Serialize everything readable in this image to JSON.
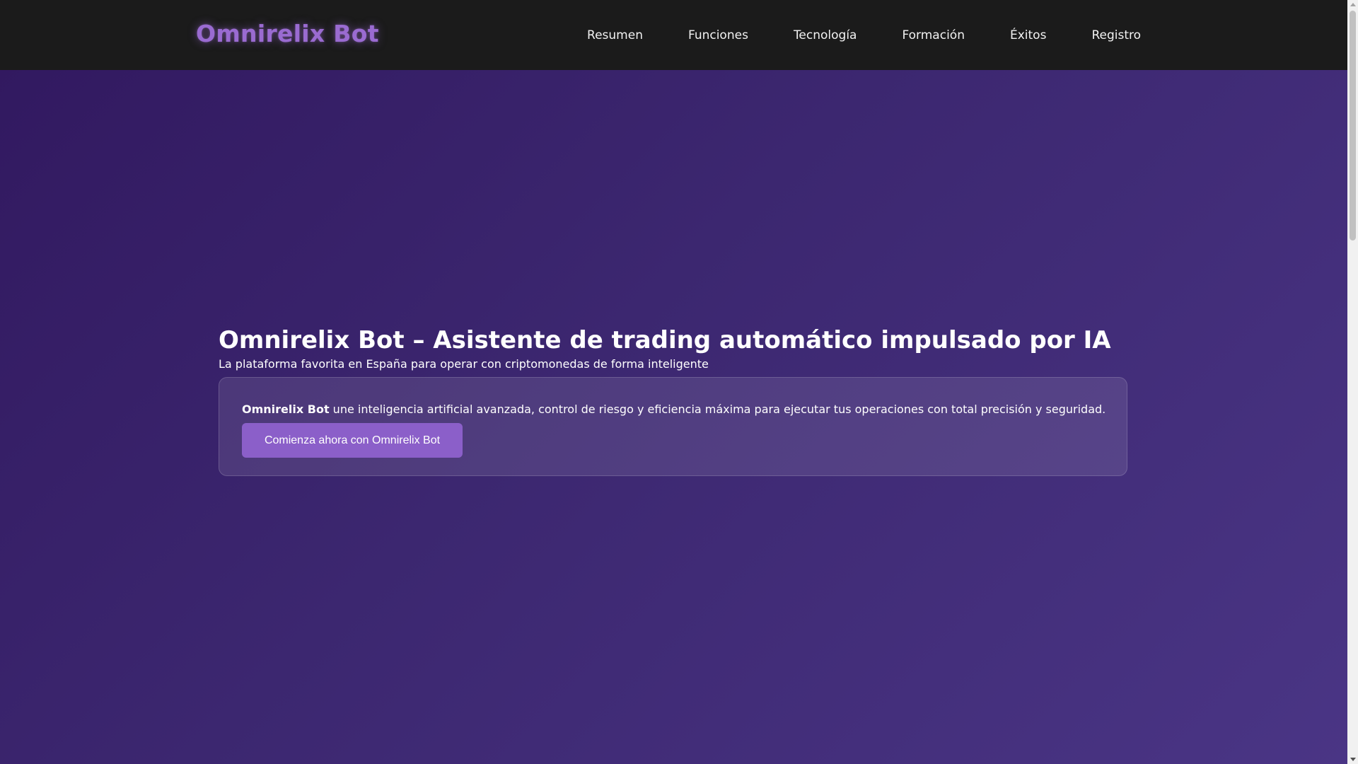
{
  "brand": {
    "name": "Omnirelix Bot",
    "accent_color": "#9a6bd1"
  },
  "nav": {
    "items": [
      {
        "label": "Resumen"
      },
      {
        "label": "Funciones"
      },
      {
        "label": "Tecnología"
      },
      {
        "label": "Formación"
      },
      {
        "label": "Éxitos"
      },
      {
        "label": "Registro"
      }
    ]
  },
  "hero": {
    "title": "Omnirelix Bot – Asistente de trading automático impulsado por IA",
    "subtitle": "La plataforma favorita en España para operar con criptomonedas de forma inteligente",
    "card": {
      "text_bold": "Omnirelix Bot",
      "text_rest": " une inteligencia artificial avanzada, control de riesgo y eficiencia máxima para ejecutar tus operaciones con total precisión y seguridad.",
      "cta_label": "Comienza ahora con Omnirelix Bot",
      "cta_color": "#8b5fc9"
    }
  },
  "colors": {
    "navbar_bg": "#1b1b1b",
    "hero_gradient_start": "#31185f",
    "hero_gradient_end": "#4a3585"
  }
}
